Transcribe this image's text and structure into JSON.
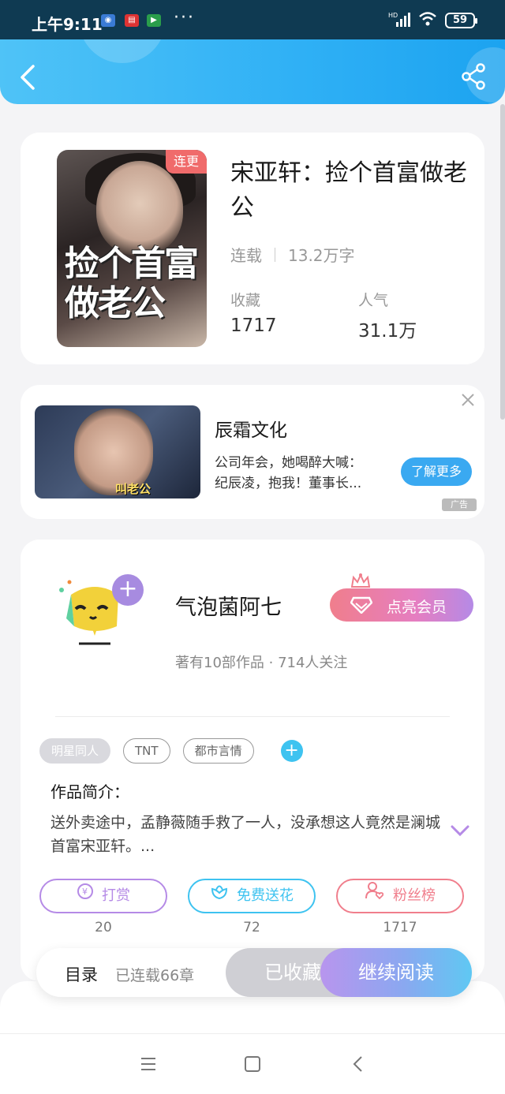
{
  "status_bar": {
    "time": "上午9:11",
    "network": "HD",
    "battery": "59"
  },
  "header": {
    "back_icon": "chevron-left-icon",
    "share_icon": "share-icon"
  },
  "book": {
    "cover_badge": "连更",
    "cover_title_art": "捡个首富做老公",
    "title": "宋亚轩：捡个首富做老公",
    "status": "连载",
    "word_count": "13.2万字",
    "favorites_label": "收藏",
    "favorites_value": "1717",
    "popularity_label": "人气",
    "popularity_value": "31.1万"
  },
  "ad": {
    "image_caption": "叫老公",
    "title": "辰霜文化",
    "description": "公司年会，她喝醉大喊：纪辰凌，抱我！董事长...",
    "button": "了解更多",
    "tag": "广告"
  },
  "author": {
    "name": "气泡菌阿七",
    "stats": "著有10部作品 · 714人关注",
    "vip_button": "点亮会员",
    "tags": [
      "明星同人",
      "TNT",
      "都市言情"
    ],
    "intro_label": "作品简介：",
    "intro_text": "送外卖途中，孟静薇随手救了一人，没承想这人竟然是澜城首富宋亚轩。...",
    "actions": [
      {
        "label": "打赏",
        "count": "20",
        "color": "#b58ae6"
      },
      {
        "label": "免费送花",
        "count": "72",
        "color": "#3ec3f0"
      },
      {
        "label": "粉丝榜",
        "count": "1717",
        "color": "#f07e8c"
      }
    ]
  },
  "read_bar": {
    "toc": "目录",
    "chapters": "已连载66章",
    "collected": "已收藏",
    "continue": "继续阅读"
  },
  "colors": {
    "header": "#2fb0f5",
    "accent": "#3ec3f0",
    "badge": "#f06b6b"
  }
}
